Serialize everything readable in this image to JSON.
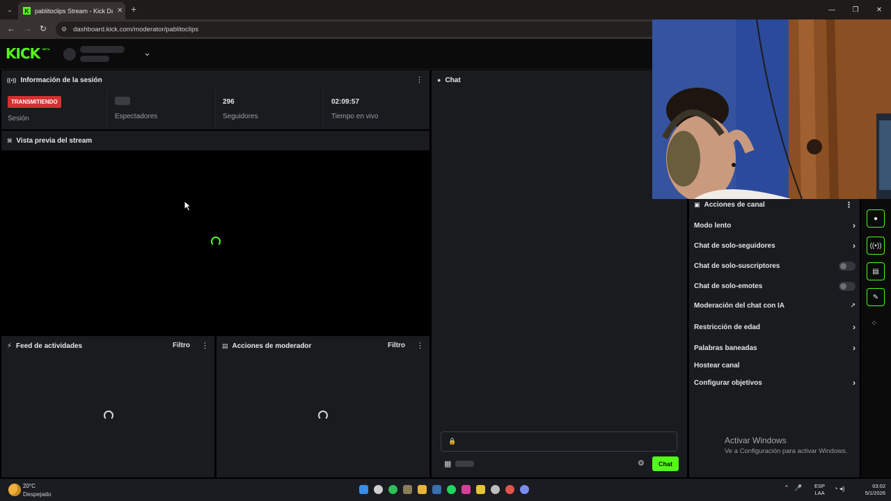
{
  "browser": {
    "tab_title": "pablitoclips Stream - Kick Dashb",
    "tab_favicon": "K",
    "tab_close": "✕",
    "new_tab": "+",
    "url": "dashboard.kick.com/moderator/pablitoclips",
    "window_controls": [
      "—",
      "❐",
      "✕"
    ]
  },
  "header": {
    "logo": "KICK",
    "beta": "BETA"
  },
  "session": {
    "title": "Información de la sesión",
    "status_badge": "TRANSMITIENDO",
    "status_label": "Sesión",
    "viewers_label": "Espectadores",
    "followers_value": "296",
    "followers_label": "Seguidores",
    "uptime_value": "02:09:57",
    "uptime_label": "Tiempo en vivo"
  },
  "preview": {
    "title": "Vista previa del stream"
  },
  "feed": {
    "title": "Feed de actividades",
    "filter": "Filtro"
  },
  "mod_actions": {
    "title": "Acciones de moderador",
    "filter": "Filtro"
  },
  "chat": {
    "title": "Chat",
    "send_label": "Chat"
  },
  "channel_actions": {
    "title": "Acciones de canal",
    "items": [
      {
        "label": "Modo lento",
        "control": "arrow"
      },
      {
        "label": "Chat de solo-seguidores",
        "control": "arrow"
      },
      {
        "label": "Chat de solo-suscriptores",
        "control": "toggle"
      },
      {
        "label": "Chat de solo-emotes",
        "control": "toggle"
      },
      {
        "label": "Moderación del chat con IA",
        "control": "external"
      },
      {
        "label": "Restricción de edad",
        "control": "arrow"
      },
      {
        "label": "Palabras baneadas",
        "control": "arrow"
      },
      {
        "label": "Hostear canal",
        "control": "none"
      },
      {
        "label": "Configurar objetivos",
        "control": "arrow"
      }
    ]
  },
  "windows_activation": {
    "title": "Activar Windows",
    "subtitle": "Ve a Configuración para activar Windows."
  },
  "taskbar": {
    "temperature": "20°C",
    "weather": "Despejado",
    "lang_top": "ESP",
    "lang_bottom": "LAA",
    "time": "03:02",
    "date": "5/1/2026"
  },
  "colors": {
    "accent": "#53fc18",
    "live": "#d43131",
    "panel": "#191b1f",
    "background": "#000000"
  }
}
